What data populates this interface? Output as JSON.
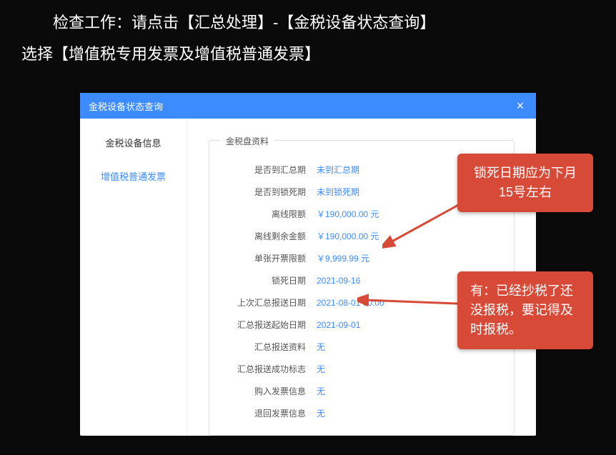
{
  "instruction_line1": "检查工作：请点击【汇总处理】-【金税设备状态查询】",
  "instruction_line2": "选择【增值税专用发票及增值税普通发票】",
  "modal": {
    "title": "金税设备状态查询",
    "close": "×",
    "sidebar": {
      "item1": "金税设备信息",
      "item2": "增值税普通发票"
    },
    "fieldset_title": "金税盘资料",
    "rows": [
      {
        "label": "是否到汇总期",
        "value": "未到汇总期"
      },
      {
        "label": "是否到锁死期",
        "value": "未到锁死期"
      },
      {
        "label": "离线限额",
        "value": "￥190,000.00 元"
      },
      {
        "label": "离线剩余金额",
        "value": "￥190,000.00 元"
      },
      {
        "label": "单张开票限额",
        "value": "￥9,999.99 元"
      },
      {
        "label": "锁死日期",
        "value": "2021-09-16"
      },
      {
        "label": "上次汇总报送日期",
        "value": "2021-08-01 00:00"
      },
      {
        "label": "汇总报送起始日期",
        "value": "2021-09-01"
      },
      {
        "label": "汇总报送资料",
        "value": "无"
      },
      {
        "label": "汇总报送成功标志",
        "value": "无"
      },
      {
        "label": "购入发票信息",
        "value": "无"
      },
      {
        "label": "退回发票信息",
        "value": "无"
      }
    ]
  },
  "callout1": "锁死日期应为下月15号左右",
  "callout2": "有：已经抄税了还没报税，要记得及时报税。"
}
